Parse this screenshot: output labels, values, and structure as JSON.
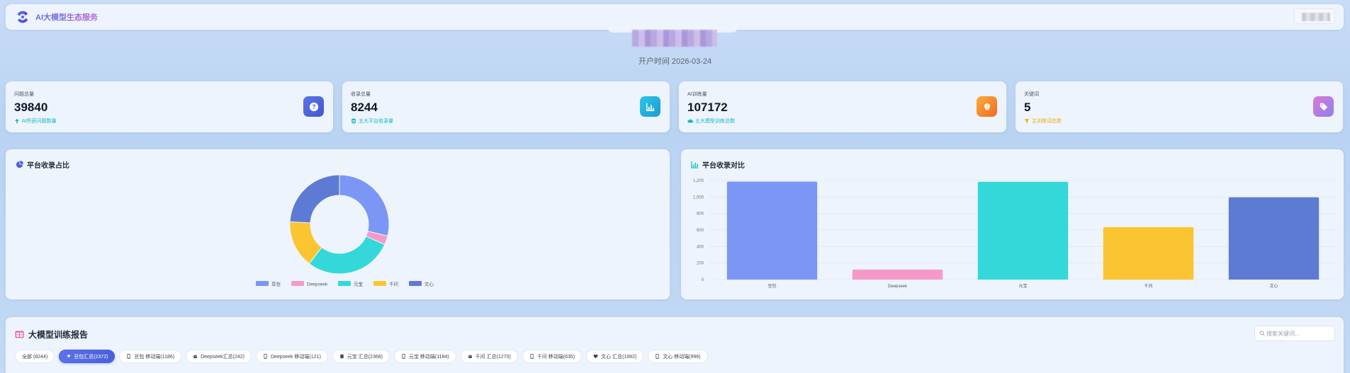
{
  "header": {
    "app_title": "AI大模型生态服务"
  },
  "open_time": "开户时间 2026-03-24",
  "stats": [
    {
      "label": "问题总量",
      "value": "39840",
      "sub": "AI所获问题数量",
      "sub_color": "#14b8c4",
      "icon": "question-icon",
      "grad": [
        "#5d74e6",
        "#4057cf"
      ]
    },
    {
      "label": "收录总量",
      "value": "8244",
      "sub": "五大平台收录量",
      "sub_color": "#14b8c4",
      "icon": "bar-chart-icon",
      "grad": [
        "#2fc6e6",
        "#1a9ad6"
      ]
    },
    {
      "label": "AI训练量",
      "value": "107172",
      "sub": "五大模型训练总数",
      "sub_color": "#14b8c4",
      "icon": "brain-icon",
      "grad": [
        "#fdab3d",
        "#f26b21"
      ]
    },
    {
      "label": "关键词",
      "value": "5",
      "sub": "主训练词总数",
      "sub_color": "#f0a800",
      "icon": "tag-icon",
      "grad": [
        "#d77ad6",
        "#8f7ff0"
      ]
    }
  ],
  "panels": {
    "pie_title": "平台收录占比",
    "bar_title": "平台收录对比"
  },
  "chart_data": [
    {
      "type": "pie",
      "title": "平台收录占比",
      "legend_position": "bottom",
      "categories": [
        "豆包",
        "Deepseek",
        "元宝",
        "千问",
        "文心"
      ],
      "values": [
        2372,
        242,
        2368,
        1270,
        1992
      ],
      "colors": [
        "#7b96f5",
        "#f59ac8",
        "#34d8d8",
        "#fbc531",
        "#5e7bd4"
      ]
    },
    {
      "type": "bar",
      "title": "平台收录对比",
      "categories": [
        "豆包",
        "Deepseek",
        "元宝",
        "千问",
        "文心"
      ],
      "values": [
        1186,
        121,
        1184,
        635,
        996
      ],
      "colors": [
        "#7b96f5",
        "#f59ac8",
        "#34d8d8",
        "#fbc531",
        "#5e7bd4"
      ],
      "ylim": [
        0,
        1200
      ],
      "yticks": [
        "0",
        "200",
        "400",
        "600",
        "800",
        "1,000",
        "1,200"
      ],
      "grid": true
    }
  ],
  "report": {
    "title": "大模型训练报告",
    "search_placeholder": "搜索关键词...",
    "tabs": [
      {
        "label": "全部 (8244)",
        "icon": "",
        "active": false
      },
      {
        "label": "豆包汇总(2372)",
        "icon": "send-icon",
        "active": true
      },
      {
        "label": "豆包 移动端(1186)",
        "icon": "phone-icon",
        "active": false
      },
      {
        "label": "Deepseek汇总(242)",
        "icon": "robot-icon",
        "active": false
      },
      {
        "label": "Deepseek 移动端(121)",
        "icon": "phone-icon",
        "active": false
      },
      {
        "label": "元宝 汇总(2368)",
        "icon": "coins-icon",
        "active": false
      },
      {
        "label": "元宝 移动端(1184)",
        "icon": "phone-icon",
        "active": false
      },
      {
        "label": "千问 汇总(1270)",
        "icon": "robot-icon",
        "active": false
      },
      {
        "label": "千问 移动端(635)",
        "icon": "phone-icon",
        "active": false
      },
      {
        "label": "文心 汇总(1992)",
        "icon": "heart-icon",
        "active": false
      },
      {
        "label": "文心 移动端(996)",
        "icon": "phone-icon",
        "active": false
      }
    ]
  }
}
